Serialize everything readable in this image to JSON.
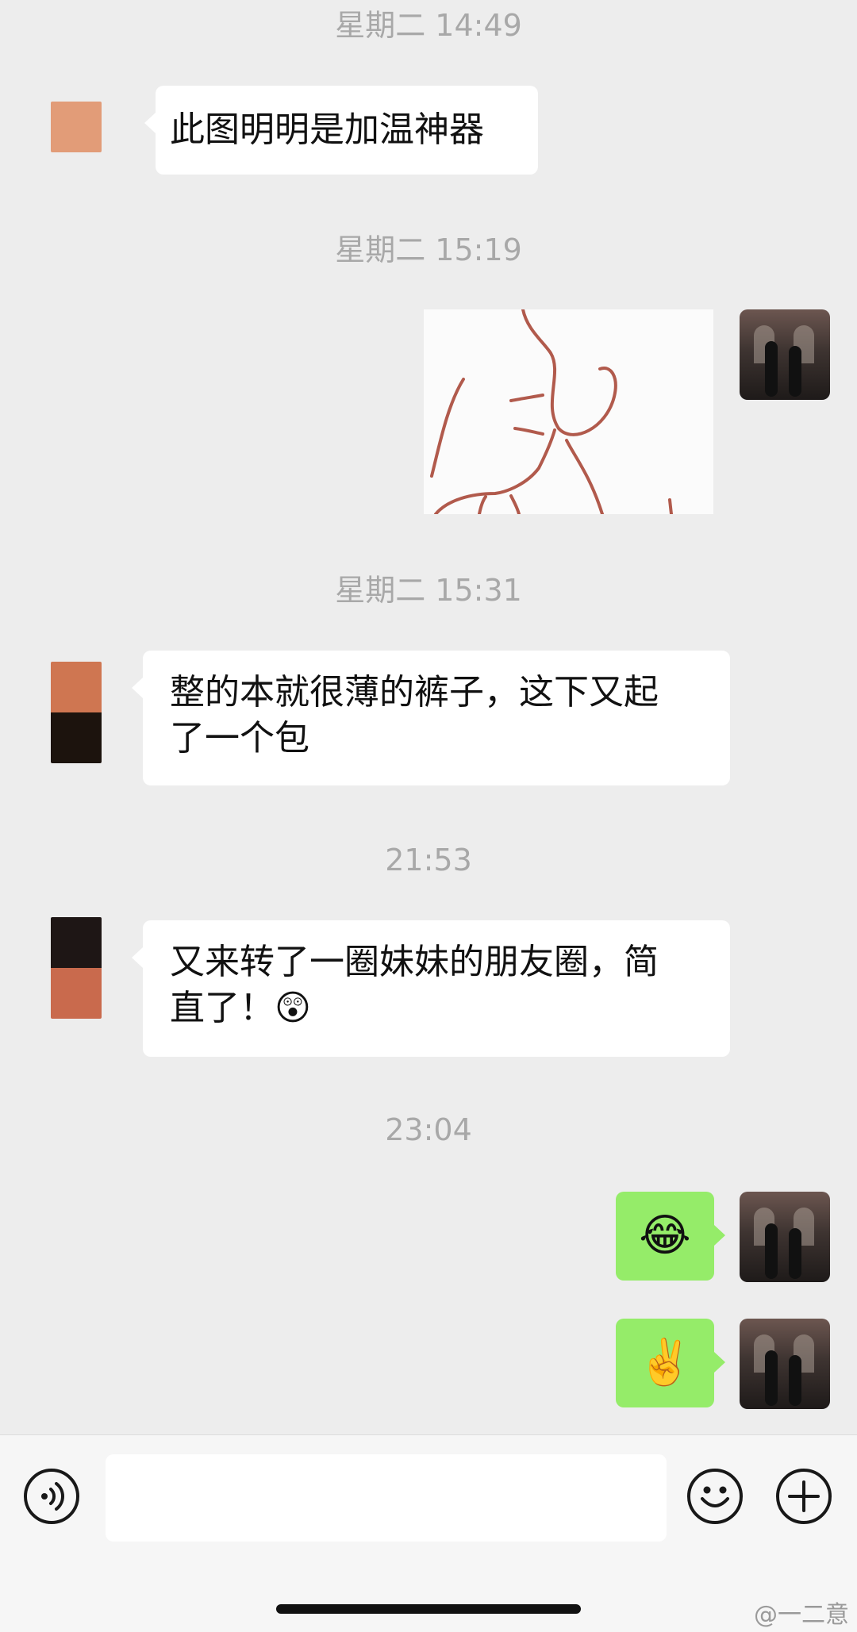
{
  "timestamps": [
    "星期二 14:49",
    "星期二 15:19",
    "星期二 15:31",
    "21:53",
    "23:04"
  ],
  "messages": {
    "m1": "此图明明是加温神器",
    "m3a": "整的本就很薄的裤子，这下又起",
    "m3b": "了一个包",
    "m4a": "又来转了一圈妹妹的朋友圈，简",
    "m4b": "直了！",
    "m4_emoji": "😲",
    "m5": "😂",
    "m6": "✌️"
  },
  "input": {
    "placeholder": ""
  },
  "watermark": "@一二意",
  "colors": {
    "chat_bg": "#ededed",
    "bubble_in": "#ffffff",
    "bubble_out": "#95ec69",
    "timestamp": "#a8a8a8"
  }
}
